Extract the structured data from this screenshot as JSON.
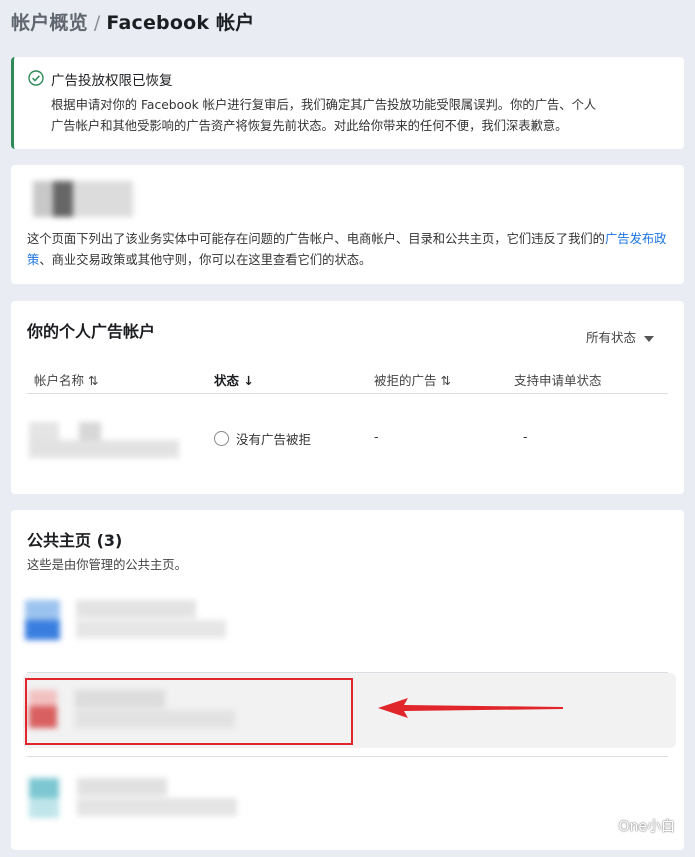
{
  "breadcrumb": {
    "parent": "帐户概览",
    "separator": "/",
    "current": "Facebook 帐户"
  },
  "banner": {
    "title": "广告投放权限已恢复",
    "line1": "根据申请对你的 Facebook 帐户进行复审后，我们确定其广告投放功能受限属误判。你的广告、个人",
    "line2": "广告帐户和其他受影响的广告资产将恢复先前状态。对此给你带来的任何不便，我们深表歉意。"
  },
  "intro": {
    "text_before": "这个页面下列出了该业务实体中可能存在问题的广告帐户、电商帐户、目录和公共主页，它们违反了我们的",
    "link": "广告发布政策",
    "text_after": "、商业交易政策或其他守则，你可以在这里查看它们的状态。"
  },
  "accounts": {
    "title": "你的个人广告帐户",
    "filter": "所有状态",
    "columns": {
      "name": "帐户名称 ⇅",
      "status": "状态 ↓",
      "rejected": "被拒的广告 ⇅",
      "appeal": "支持申请单状态"
    },
    "row": {
      "status": "没有广告被拒",
      "rejected": "-",
      "appeal": "-"
    }
  },
  "pages": {
    "title": "公共主页 (3)",
    "subtitle": "这些是由你管理的公共主页。"
  },
  "watermark": "One小白",
  "colors": {
    "link": "#1b74e4",
    "success": "#2e8b57",
    "annotation": "#e0262a"
  }
}
